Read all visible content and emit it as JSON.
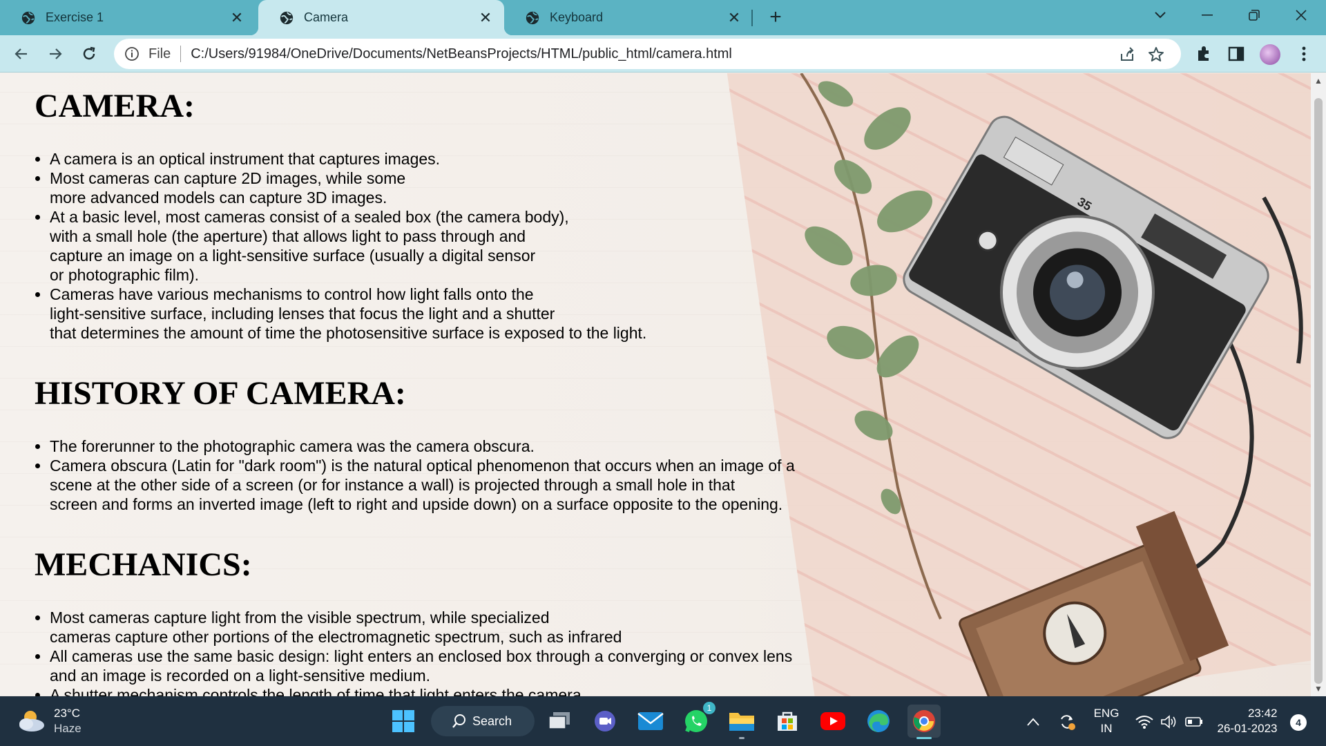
{
  "browser": {
    "tabs": [
      {
        "title": "Exercise 1",
        "active": false
      },
      {
        "title": "Camera",
        "active": true
      },
      {
        "title": "Keyboard",
        "active": false
      }
    ],
    "address": {
      "scheme_label": "File",
      "url": "C:/Users/91984/OneDrive/Documents/NetBeansProjects/HTML/public_html/camera.html"
    }
  },
  "page": {
    "heading_camera": "CAMERA:",
    "camera_items": [
      "A camera is an optical instrument that captures images.",
      "Most cameras can capture 2D images, while some\nmore advanced models can capture 3D images.",
      "At a basic level, most cameras consist of a sealed box (the camera body),\nwith a small hole (the aperture) that allows light to pass through and\ncapture an image on a light-sensitive surface (usually a digital sensor\nor photographic film).",
      "Cameras have various mechanisms to control how light falls onto the\nlight-sensitive surface, including lenses that focus the light and a shutter\nthat determines the amount of time the photosensitive surface is exposed to the light."
    ],
    "heading_history": "HISTORY OF CAMERA:",
    "history_items": [
      "The forerunner to the photographic camera was the camera obscura.",
      "Camera obscura (Latin for \"dark room\") is the natural optical phenomenon that occurs when an image of a\nscene at the other side of a screen (or for instance a wall) is projected through a small hole in that\nscreen and forms an inverted image (left to right and upside down) on a surface opposite to the opening."
    ],
    "heading_mechanics": "MECHANICS:",
    "mechanics_items": [
      "Most cameras capture light from the visible spectrum, while specialized\ncameras capture other portions of the electromagnetic spectrum, such as infrared",
      "All cameras use the same basic design: light enters an enclosed box through a converging or convex lens\nand an image is recorded on a light-sensitive medium.",
      "A shutter mechanism controls the length of time that light enters the camera."
    ],
    "camera_label": "35"
  },
  "taskbar": {
    "weather_temp": "23°C",
    "weather_desc": "Haze",
    "search_label": "Search",
    "whatsapp_badge": "1",
    "lang_line1": "ENG",
    "lang_line2": "IN",
    "time": "23:42",
    "date": "26-01-2023",
    "notification_count": "4"
  },
  "colors": {
    "tabstrip": "#5bb3c3",
    "toolbar": "#c7e8ee",
    "taskbar": "#1f3040"
  }
}
